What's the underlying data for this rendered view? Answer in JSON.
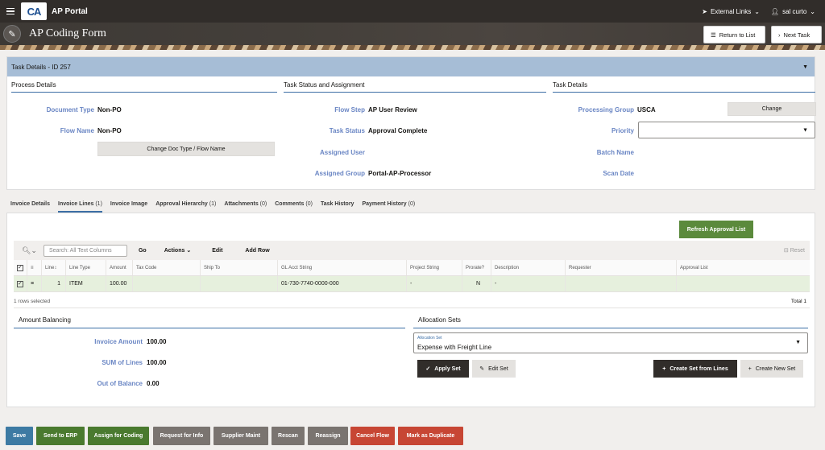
{
  "topbar": {
    "logo_text": "CA",
    "app_title": "AP Portal",
    "external_links": "External Links",
    "user": "sal curto"
  },
  "banner": {
    "title": "AP Coding Form",
    "return_label": "Return to List",
    "next_label": "Next Task"
  },
  "task": {
    "header": "Task Details - ID 257",
    "process": {
      "heading": "Process Details",
      "doc_type_label": "Document Type",
      "doc_type_value": "Non-PO",
      "flow_name_label": "Flow Name",
      "flow_name_value": "Non-PO",
      "change_btn": "Change Doc Type / Flow Name"
    },
    "status": {
      "heading": "Task Status and Assignment",
      "flow_step_label": "Flow Step",
      "flow_step_value": "AP User Review",
      "task_status_label": "Task Status",
      "task_status_value": "Approval Complete",
      "assigned_user_label": "Assigned User",
      "assigned_group_label": "Assigned Group",
      "assigned_group_value": "Portal-AP-Processor"
    },
    "details": {
      "heading": "Task Details",
      "proc_group_label": "Processing Group",
      "proc_group_value": "USCA",
      "change_btn": "Change",
      "priority_label": "Priority",
      "batch_label": "Batch Name",
      "scan_label": "Scan Date"
    }
  },
  "tabs": [
    {
      "label": "Invoice Details",
      "count": ""
    },
    {
      "label": "Invoice Lines",
      "count": "(1)"
    },
    {
      "label": "Invoice Image",
      "count": ""
    },
    {
      "label": "Approval Hierarchy",
      "count": "(1)"
    },
    {
      "label": "Attachments",
      "count": "(0)"
    },
    {
      "label": "Comments",
      "count": "(0)"
    },
    {
      "label": "Task History",
      "count": ""
    },
    {
      "label": "Payment History",
      "count": "(0)"
    }
  ],
  "lines": {
    "refresh_btn": "Refresh Approval List",
    "search_placeholder": "Search: All Text Columns",
    "go": "Go",
    "actions": "Actions",
    "edit": "Edit",
    "add_row": "Add Row",
    "reset": "Reset",
    "columns": [
      "Line",
      "Line Type",
      "Amount",
      "Tax Code",
      "Ship To",
      "GL Acct String",
      "Project String",
      "Prorate?",
      "Description",
      "Requester",
      "Approval List"
    ],
    "row": {
      "line": "1",
      "line_type": "ITEM",
      "amount": "100.00",
      "tax_code": "",
      "ship_to": "",
      "gl": "01-730-7740-0000-000",
      "project": "-",
      "prorate": "N",
      "description": "-",
      "requester": "",
      "approval": ""
    },
    "rows_selected": "1 rows selected",
    "total": "Total 1"
  },
  "balancing": {
    "heading": "Amount Balancing",
    "invoice_amount_label": "Invoice Amount",
    "invoice_amount_value": "100.00",
    "sum_lines_label": "SUM of Lines",
    "sum_lines_value": "100.00",
    "out_balance_label": "Out of Balance",
    "out_balance_value": "0.00"
  },
  "allocation": {
    "heading": "Allocation Sets",
    "select_label": "Allocation Set",
    "select_value": "Expense with Freight Line",
    "apply": "Apply Set",
    "edit": "Edit Set",
    "create_from_lines": "Create Set from Lines",
    "create_new": "Create New Set"
  },
  "footer": {
    "save": "Save",
    "send_erp": "Send to ERP",
    "assign_coding": "Assign for Coding",
    "request_info": "Request for Info",
    "supplier_maint": "Supplier Maint",
    "rescan": "Rescan",
    "reassign": "Reassign",
    "cancel_flow": "Cancel Flow",
    "mark_duplicate": "Mark as Duplicate"
  }
}
